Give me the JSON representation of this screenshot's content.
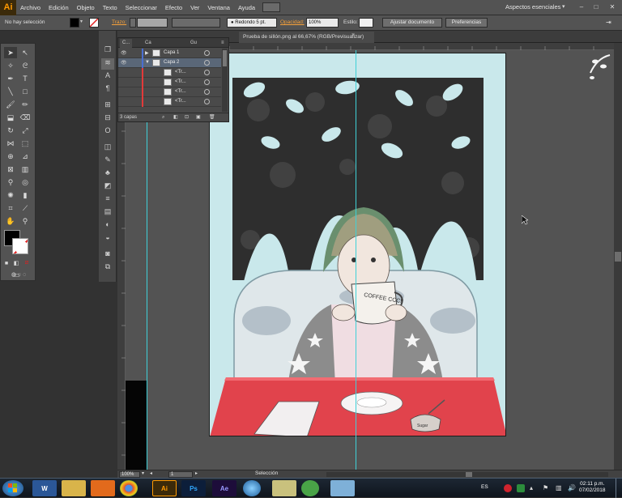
{
  "menubar": {
    "logo": "Ai",
    "items": [
      "Archivo",
      "Edición",
      "Objeto",
      "Texto",
      "Seleccionar",
      "Efecto",
      "Ver",
      "Ventana",
      "Ayuda"
    ],
    "workspace": "Aspectos esenciales",
    "win_min": "–",
    "win_max": "□",
    "win_close": "✕"
  },
  "control_bar": {
    "selection": "No hay selección",
    "stroke_label": "Trazo:",
    "brush": "Redondo 5 pt.",
    "opacity_label": "Opacidad:",
    "opacity_value": "100%",
    "style_label": "Estilo:",
    "doc_setup_button": "Ajustar documento",
    "prefs_button": "Preferencias"
  },
  "document": {
    "tab_title": "Prueba de sillón.png al 66,67% (RGB/Previsualizar)",
    "close": "×"
  },
  "layers_panel": {
    "tabs": [
      "C...",
      "Ca",
      "Gu"
    ],
    "rows": [
      {
        "name": "Capa 1",
        "expanded": false
      },
      {
        "name": "Capa 2",
        "expanded": true
      },
      {
        "name": "<Tr..."
      },
      {
        "name": "<Tr..."
      },
      {
        "name": "<Tr..."
      },
      {
        "name": "<Tr..."
      }
    ],
    "footer": "3 capas"
  },
  "status_bar": {
    "zoom": "100%",
    "artboard": "1",
    "tool": "Selección"
  },
  "taskbar": {
    "apps": [
      "W",
      "",
      "",
      "",
      "Ai",
      "Ps",
      "Ae",
      "",
      "",
      "",
      ""
    ],
    "lang": "ES",
    "time": "02:11 p.m.",
    "date": "07/02/2018"
  },
  "artwork": {
    "mug_text": "COFFEE CCC!!",
    "sugar_label": "Sugar"
  },
  "colors": {
    "accent": "#ff9a00",
    "artboard_bg": "#c9e8eb",
    "table_red": "#e1434c"
  }
}
